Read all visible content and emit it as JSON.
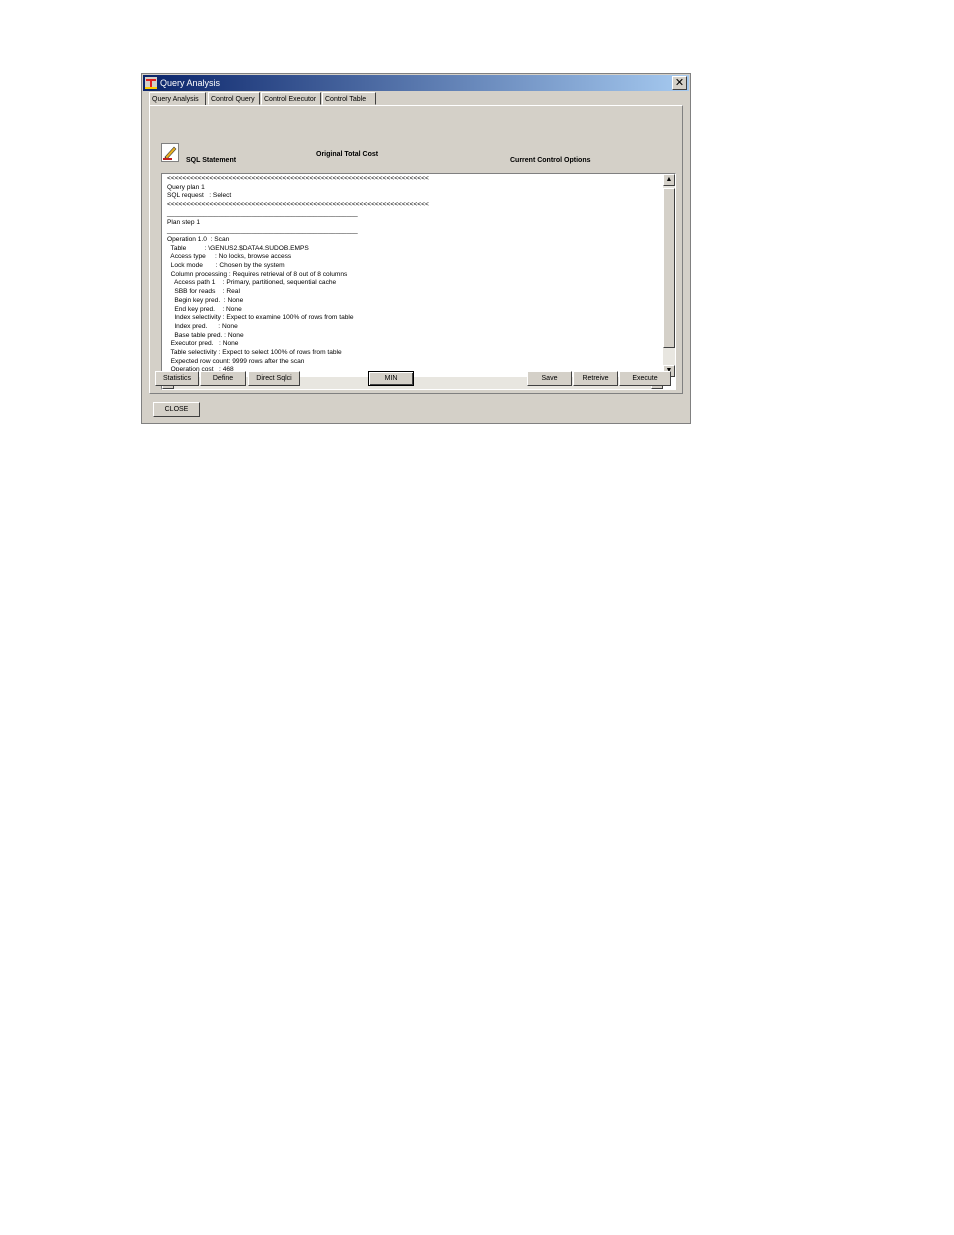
{
  "window": {
    "title": "Query Analysis",
    "close_glyph": "✕"
  },
  "tabs": [
    "Query Analysis",
    "Control Query",
    "Control Executor",
    "Control Table"
  ],
  "header": {
    "sql_statement": "SQL Statement",
    "original_total_cost": "Original Total Cost",
    "current_control_options": "Current Control Options"
  },
  "plan_text": "<<<<<<<<<<<<<<<<<<<<<<<<<<<<<<<<<<<<<<<<<<<<<<<<<<<<<<<<<<<<<<<<<<<<\nQuery plan 1\nSQL request   : Select\n<<<<<<<<<<<<<<<<<<<<<<<<<<<<<<<<<<<<<<<<<<<<<<<<<<<<<<<<<<<<<<<<<<<<\n____________________________________________________\nPlan step 1\n____________________________________________________\nOperation 1.0  : Scan\n  Table          : \\GENUS2.$DATA4.SUDOB.EMPS\n  Access type     : No locks, browse access\n  Lock mode       : Chosen by the system\n  Column processing : Requires retrieval of 8 out of 8 columns\n    Access path 1    : Primary, partitioned, sequential cache\n    SBB for reads    : Real\n    Begin key pred.  : None\n    End key pred.    : None\n    Index selectivity : Expect to examine 100% of rows from table\n    Index pred.      : None\n    Base table pred. : None\n  Executor pred.   : None\n  Table selectivity : Expect to select 100% of rows from table\n  Expected row count: 9999 rows after the scan\n  Operation cost   : 468",
  "buttons": {
    "statistics": "Statistics",
    "define": "Define",
    "direct_sql": "Direct Sqlci",
    "min": "MIN",
    "save": "Save",
    "retrieve": "Retreive",
    "execute": "Execute",
    "close": "CLOSE"
  },
  "icons": {
    "app": "tandem-logo-icon",
    "sql": "pencil-edit-icon",
    "scroll_up": "▲",
    "scroll_down": "▼",
    "scroll_left": "◀",
    "scroll_right": "▶"
  },
  "colors": {
    "titlebar_start": "#0a246a",
    "titlebar_end": "#a6caf0",
    "face": "#d4d0c8"
  }
}
